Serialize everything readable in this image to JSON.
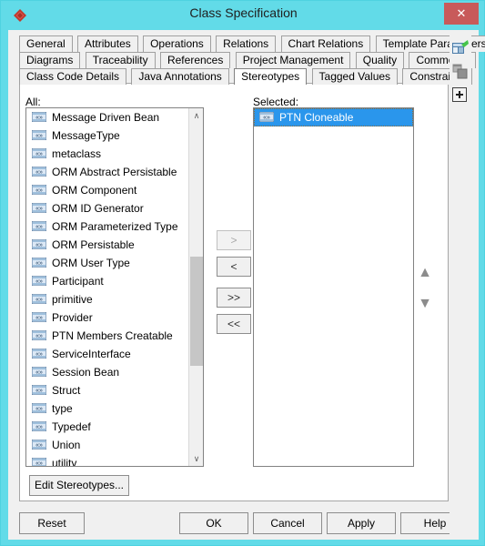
{
  "window": {
    "title": "Class Specification",
    "app_icon": "red-diamond-icon",
    "close_label": "✕",
    "titlebar_color": "#62dbe8",
    "close_color": "#c85a5a",
    "accent_color": "#2a96ec"
  },
  "tabs": {
    "rows": [
      [
        {
          "label": "General",
          "active": false
        },
        {
          "label": "Attributes",
          "active": false
        },
        {
          "label": "Operations",
          "active": false
        },
        {
          "label": "Relations",
          "active": false
        },
        {
          "label": "Chart Relations",
          "active": false
        },
        {
          "label": "Template Parameters",
          "active": false
        }
      ],
      [
        {
          "label": "Diagrams",
          "active": false
        },
        {
          "label": "Traceability",
          "active": false
        },
        {
          "label": "References",
          "active": false
        },
        {
          "label": "Project Management",
          "active": false
        },
        {
          "label": "Quality",
          "active": false
        },
        {
          "label": "Comments",
          "active": false
        }
      ],
      [
        {
          "label": "Class Code Details",
          "active": false
        },
        {
          "label": "Java Annotations",
          "active": false
        },
        {
          "label": "Stereotypes",
          "active": true
        },
        {
          "label": "Tagged Values",
          "active": false
        },
        {
          "label": "Constraints",
          "active": false
        }
      ]
    ]
  },
  "panels": {
    "all_label": "All:",
    "selected_label": "Selected:",
    "all_items": [
      "Message Driven Bean",
      "MessageType",
      "metaclass",
      "ORM Abstract Persistable",
      "ORM Component",
      "ORM ID Generator",
      "ORM Parameterized Type",
      "ORM Persistable",
      "ORM User Type",
      "Participant",
      "primitive",
      "Provider",
      "PTN Members Creatable",
      "ServiceInterface",
      "Session Bean",
      "Struct",
      "type",
      "Typedef",
      "Union",
      "utility"
    ],
    "selected_items": [
      {
        "label": "PTN Cloneable",
        "selected": true
      }
    ],
    "item_icon": "stereotype-guillemet-icon"
  },
  "transfer_buttons": [
    {
      "name": "add",
      "label": ">",
      "disabled": true
    },
    {
      "name": "remove",
      "label": "<",
      "disabled": false
    },
    {
      "name": "add-all",
      "label": ">>",
      "disabled": false
    },
    {
      "name": "remove-all",
      "label": "<<",
      "disabled": false
    }
  ],
  "move_buttons": {
    "up_label": "▲",
    "down_label": "▼"
  },
  "scrollbar": {
    "up_arrow": "∧",
    "down_arrow": "∨"
  },
  "actions": {
    "edit_stereotypes": "Edit Stereotypes..."
  },
  "dialog_buttons": [
    {
      "name": "reset",
      "label": "Reset"
    },
    {
      "name": "ok",
      "label": "OK"
    },
    {
      "name": "cancel",
      "label": "Cancel"
    },
    {
      "name": "apply",
      "label": "Apply"
    },
    {
      "name": "help",
      "label": "Help"
    }
  ],
  "side_toolbar": [
    {
      "name": "chart-new-icon"
    },
    {
      "name": "copy-shapes-icon"
    },
    {
      "name": "add-plus-icon"
    }
  ]
}
